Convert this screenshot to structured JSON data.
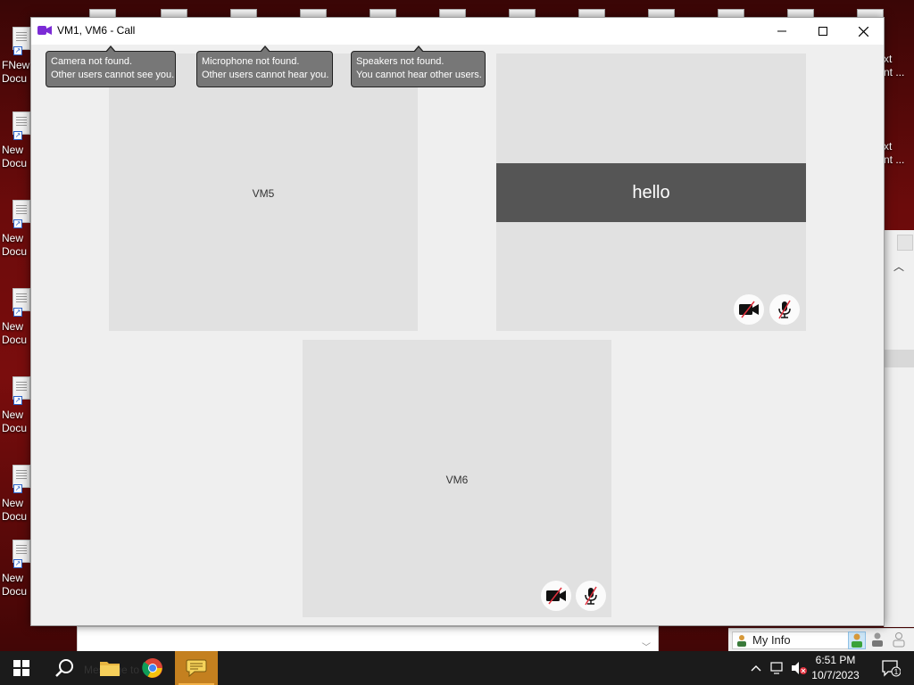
{
  "window": {
    "title": "VM1, VM6 - Call"
  },
  "notifications": [
    {
      "line1": "Camera not found.",
      "line2": "Other users cannot see you."
    },
    {
      "line1": "Microphone not found.",
      "line2": "Other users cannot hear you."
    },
    {
      "line1": "Speakers not found.",
      "line2": "You cannot hear other users."
    }
  ],
  "participants": {
    "vm5": {
      "name": "VM5"
    },
    "self": {
      "caption": "hello"
    },
    "vm6": {
      "name": "VM6"
    }
  },
  "desktop": {
    "left_icon_labels": [
      {
        "line1": "FNew",
        "line2": "Docu"
      },
      {
        "line1": "New",
        "line2": "Docu"
      },
      {
        "line1": "New",
        "line2": "Docu"
      },
      {
        "line1": "New",
        "line2": "Docu"
      },
      {
        "line1": "New",
        "line2": "Docu"
      },
      {
        "line1": "New",
        "line2": "Docu"
      },
      {
        "line1": "New",
        "line2": "Docu"
      }
    ],
    "right_icon_labels": [
      {
        "line1": "xt",
        "line2": "nt ..."
      },
      {
        "line1": "xt",
        "line2": "nt ..."
      }
    ]
  },
  "messenger_panel": {
    "my_info": "My Info"
  },
  "taskbar": {
    "background_text": "Message to",
    "time": "6:51 PM",
    "date": "10/7/2023",
    "notification_count": "1"
  },
  "colors": {
    "tile_bg": "#e1e1e1",
    "window_bg": "#efefef",
    "banner_bg": "#555555",
    "tooltip_bg": "#777777",
    "taskbar_bg": "#1b1b1b",
    "active_taskbar_item": "#c4801f",
    "camera_icon": "#7b2bd6",
    "muted_slash": "#e0303d"
  },
  "icons": {
    "app": "video-camera-icon",
    "camera_off": "camera-off-icon",
    "mic_off": "microphone-off-icon"
  }
}
